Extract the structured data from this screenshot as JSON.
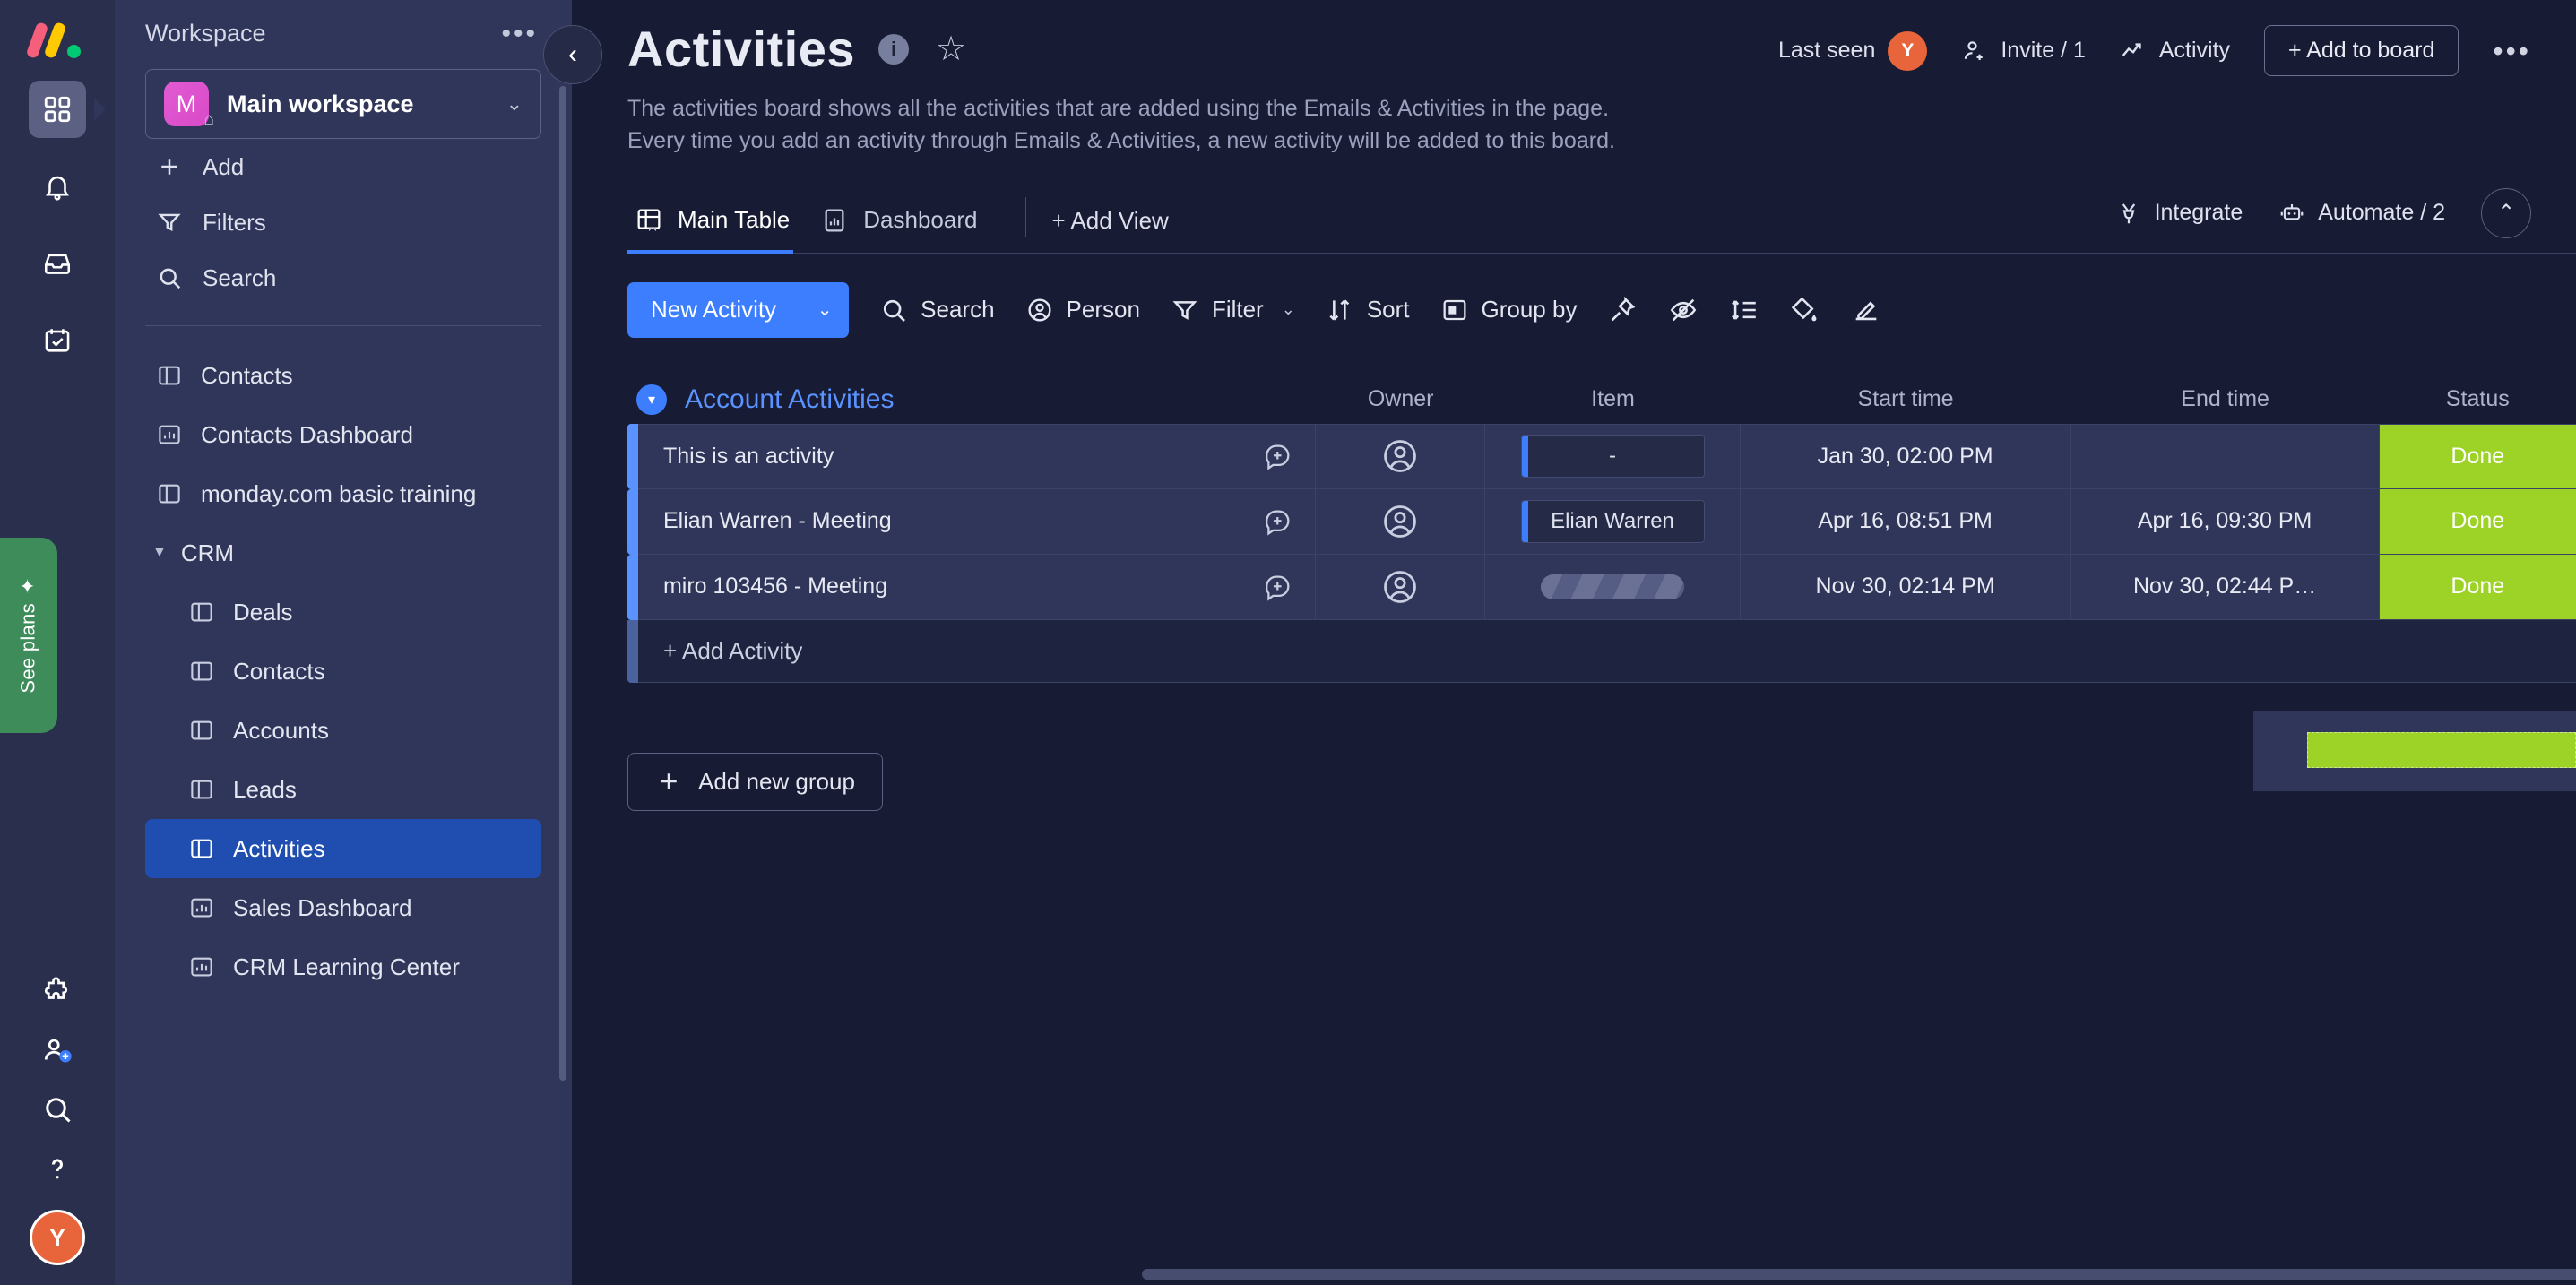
{
  "rail": {
    "logo": "monday-logo",
    "items": [
      {
        "name": "home-grid-icon",
        "active": true
      },
      {
        "name": "notifications-bell-icon",
        "active": false
      },
      {
        "name": "inbox-icon",
        "active": false
      },
      {
        "name": "my-work-calendar-icon",
        "active": false
      }
    ],
    "see_plans": "See plans",
    "bottom_items": [
      {
        "name": "apps-puzzle-icon"
      },
      {
        "name": "invite-members-icon"
      },
      {
        "name": "search-icon"
      },
      {
        "name": "help-icon"
      }
    ],
    "avatar_initial": "Y"
  },
  "sidebar": {
    "header": "Workspace",
    "more_label": "•••",
    "workspace": {
      "initial": "M",
      "name": "Main workspace",
      "caret": "⌄"
    },
    "actions": [
      {
        "label": "Add",
        "icon": "plus-icon"
      },
      {
        "label": "Filters",
        "icon": "filter-icon"
      },
      {
        "label": "Search",
        "icon": "search-icon"
      }
    ],
    "boards": [
      {
        "label": "Contacts",
        "icon": "board-icon",
        "type": "board",
        "indent": false,
        "selected": false
      },
      {
        "label": "Contacts Dashboard",
        "icon": "dashboard-icon",
        "type": "dashboard",
        "indent": false,
        "selected": false
      },
      {
        "label": "monday.com basic training",
        "icon": "board-icon",
        "type": "board",
        "indent": false,
        "selected": false
      },
      {
        "label": "CRM",
        "icon": "folder-caret-icon",
        "type": "folder",
        "indent": false,
        "selected": false
      },
      {
        "label": "Deals",
        "icon": "board-icon",
        "type": "board",
        "indent": true,
        "selected": false
      },
      {
        "label": "Contacts",
        "icon": "board-icon",
        "type": "board",
        "indent": true,
        "selected": false
      },
      {
        "label": "Accounts",
        "icon": "board-icon",
        "type": "board",
        "indent": true,
        "selected": false
      },
      {
        "label": "Leads",
        "icon": "board-icon",
        "type": "board",
        "indent": true,
        "selected": false
      },
      {
        "label": "Activities",
        "icon": "board-icon",
        "type": "board",
        "indent": true,
        "selected": true
      },
      {
        "label": "Sales Dashboard",
        "icon": "dashboard-icon",
        "type": "dashboard",
        "indent": true,
        "selected": false
      },
      {
        "label": "CRM Learning Center",
        "icon": "dashboard-icon",
        "type": "dashboard",
        "indent": true,
        "selected": false
      }
    ]
  },
  "header": {
    "title": "Activities",
    "info_icon": "info-icon",
    "star_icon": "star-icon",
    "description_line1": "The activities board shows all the activities that are added using the Emails & Activities in the page.",
    "description_line2": "Every time you add an activity through Emails & Activities, a new activity will be added to this board.",
    "last_seen_label": "Last seen",
    "last_seen_avatar": "Y",
    "invite_label": "Invite / 1",
    "activity_label": "Activity",
    "add_to_board_label": "+ Add to board",
    "more_label": "•••"
  },
  "tabs": {
    "items": [
      {
        "label": "Main Table",
        "icon": "main-table-icon",
        "active": true
      },
      {
        "label": "Dashboard",
        "icon": "dashboard-icon",
        "active": false
      }
    ],
    "add_view_label": "+ Add View",
    "integrate_label": "Integrate",
    "automate_label": "Automate / 2",
    "collapse_label": "⌃"
  },
  "toolbar": {
    "new_activity_label": "New Activity",
    "new_activity_caret": "⌄",
    "search_label": "Search",
    "person_label": "Person",
    "filter_label": "Filter",
    "filter_caret": "⌄",
    "sort_label": "Sort",
    "group_by_label": "Group by",
    "icons": [
      {
        "name": "pin-icon"
      },
      {
        "name": "hide-eye-icon"
      },
      {
        "name": "row-height-icon"
      },
      {
        "name": "color-fill-icon"
      },
      {
        "name": "edit-board-icon"
      }
    ]
  },
  "table": {
    "group_title": "Account Activities",
    "group_caret": "▾",
    "columns": [
      "Owner",
      "Item",
      "Start time",
      "End time",
      "Status"
    ],
    "rows": [
      {
        "name": "This is an activity",
        "owner": "person-empty-icon",
        "item": "-",
        "item_type": "text",
        "start_time": "Jan 30, 02:00 PM",
        "end_time": "",
        "status": "Done",
        "status_color": "#9cd326"
      },
      {
        "name": "Elian Warren - Meeting",
        "owner": "person-empty-icon",
        "item": "Elian Warren",
        "item_type": "chip",
        "start_time": "Apr 16, 08:51 PM",
        "end_time": "Apr 16, 09:30 PM",
        "status": "Done",
        "status_color": "#9cd326"
      },
      {
        "name": "miro 103456 - Meeting",
        "owner": "person-empty-icon",
        "item": "",
        "item_type": "skeleton",
        "start_time": "Nov 30, 02:14 PM",
        "end_time": "Nov 30, 02:44 P…",
        "status": "Done",
        "status_color": "#9cd326"
      }
    ],
    "add_activity_label": "+ Add Activity",
    "add_new_group_label": "Add new group"
  },
  "colors": {
    "accent_blue": "#3d7eff",
    "status_green": "#9cd326",
    "sidebar_bg": "#30365a",
    "main_bg": "#181b34",
    "rail_bg": "#292f4c",
    "selected_board": "#1f4eb0",
    "avatar_orange": "#e8643b",
    "plans_green": "#3f8c5b"
  }
}
